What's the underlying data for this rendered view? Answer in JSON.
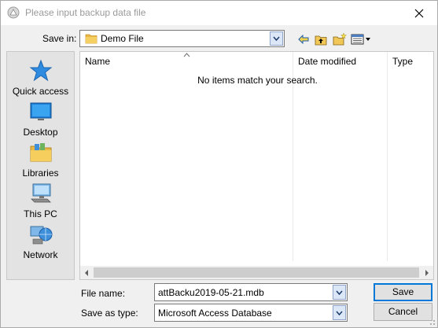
{
  "window": {
    "title": "Please input backup data file"
  },
  "save_in": {
    "label": "Save in:",
    "value": "Demo File"
  },
  "places": [
    {
      "label": "Quick access",
      "icon": "star-icon"
    },
    {
      "label": "Desktop",
      "icon": "desktop-icon"
    },
    {
      "label": "Libraries",
      "icon": "libraries-icon"
    },
    {
      "label": "This PC",
      "icon": "computer-icon"
    },
    {
      "label": "Network",
      "icon": "network-icon"
    }
  ],
  "file_list": {
    "columns": [
      "Name",
      "Date modified",
      "Type"
    ],
    "empty_message": "No items match your search."
  },
  "file_name": {
    "label": "File name:",
    "value": "attBacku2019-05-21.mdb"
  },
  "save_as_type": {
    "label": "Save as type:",
    "value": "Microsoft Access Database"
  },
  "buttons": {
    "save": "Save",
    "cancel": "Cancel"
  },
  "colors": {
    "accent": "#0078d7",
    "folder": "#e8b745",
    "title_text": "#9a9a9a"
  }
}
